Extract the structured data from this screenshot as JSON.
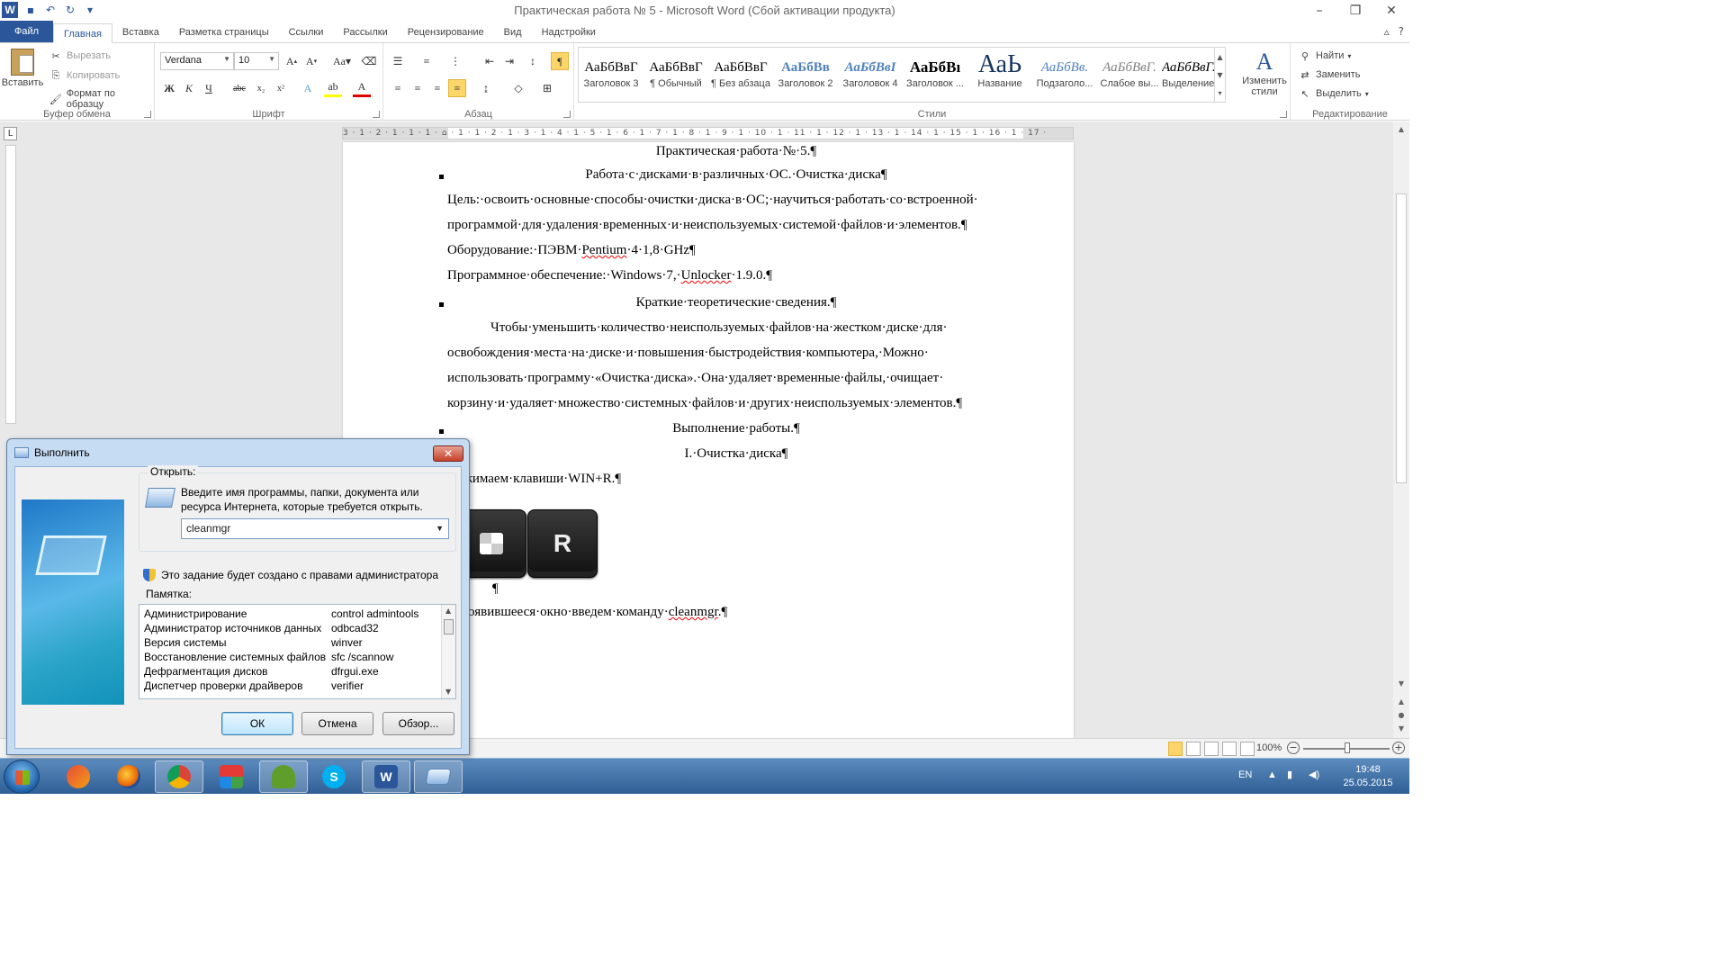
{
  "window": {
    "title": "Практическая работа № 5 - Microsoft Word (Сбой активации продукта)",
    "app_icon": "W"
  },
  "ribbon_tabs": [
    "Файл",
    "Главная",
    "Вставка",
    "Разметка страницы",
    "Ссылки",
    "Рассылки",
    "Рецензирование",
    "Вид",
    "Надстройки"
  ],
  "clipboard": {
    "paste": "Вставить",
    "cut": "Вырезать",
    "copy": "Копировать",
    "format_painter": "Формат по образцу",
    "group": "Буфер обмена"
  },
  "font": {
    "name": "Verdana",
    "size": "10",
    "group": "Шрифт"
  },
  "paragraph": {
    "group": "Абзац"
  },
  "styles": {
    "group": "Стили",
    "items": [
      {
        "sample": "АаБбВвГ",
        "name": "Заголовок 3"
      },
      {
        "sample": "АаБбВвГ",
        "name": "¶ Обычный"
      },
      {
        "sample": "АаБбВвГ",
        "name": "¶ Без абзаца"
      },
      {
        "sample": "АаБбВв",
        "name": "Заголовок 2"
      },
      {
        "sample": "АаБбВвI",
        "name": "Заголовок 4"
      },
      {
        "sample": "АаБбВı",
        "name": "Заголовок ..."
      },
      {
        "sample": "АаЬ",
        "name": "Название"
      },
      {
        "sample": "АаБбВв.",
        "name": "Подзаголо..."
      },
      {
        "sample": "АаБбВвГ.",
        "name": "Слабое вы..."
      },
      {
        "sample": "АаБбВвГ.",
        "name": "Выделение"
      }
    ],
    "change_styles": "Изменить стили"
  },
  "editing": {
    "group": "Редактирование",
    "find": "Найти",
    "replace": "Заменить",
    "select": "Выделить"
  },
  "ruler_text": "3 · 1 · 2 · 1 · 1 · 1 · ⌂ · 1 · 1 · 2 · 1 · 3 · 1 · 4 · 1 · 5 · 1 · 6 · 1 · 7 · 1 · 8 · 1 · 9 · 1 · 10 · 1 · 11 · 1 · 12 · 1 · 13 · 1 · 14 · 1 · 15 · 1 · 16 · 1 · 17 ·",
  "document": {
    "title": "Практическая·работа·№·5.¶",
    "heading1": "Работа·с·дисками·в·различных·ОС.·Очистка·диска¶",
    "goal1": "Цель:·освоить·основные·способы·очистки·диска·в·ОС;·научиться·работать·со·встроенной·",
    "goal2": "программой·для·удаления·временных·и·неиспользуемых·системой·файлов·и·элементов.¶",
    "equip_pre": "Оборудование:·ПЭВМ·",
    "equip_word": "Pentium",
    "equip_post": "·4·1,8·GHz¶",
    "soft_pre": "Программное·обеспечение:·Windows·7,·",
    "soft_word": "Unlocker",
    "soft_post": "·1.9.0.¶",
    "theory": "Краткие·теоретические·сведения.¶",
    "p1": "Чтобы·уменьшить·количество·неиспользуемых·файлов·на·жестком·диске·для·",
    "p2": "освобождения·места·на·диске·и·повышения·быстродействия·компьютера,·Можно·",
    "p3": "использовать·программу·«Очистка·диска».·Она·удаляет·временные·файлы,·очищает·",
    "p4": "корзину·и·удаляет·множество·системных·файлов·и·других·неиспользуемых·элементов.¶",
    "work": "Выполнение·работы.¶",
    "section": "I.·Очистка·диска¶",
    "press": "Нажимаем·клавиши·WIN+R.¶",
    "key_r": "R",
    "empty_para": "¶",
    "cmd_pre": "В·появившееся·окно·введем·команду·",
    "cmd_word": "cleanmgr",
    "cmd_post": ".¶"
  },
  "statusbar": {
    "zoom": "100%"
  },
  "taskbar": {
    "lang": "EN",
    "time": "19:48",
    "date": "25.05.2015"
  },
  "run_dialog": {
    "title": "Выполнить",
    "open_label": "Открыть:",
    "description": "Введите имя программы, папки, документа или ресурса Интернета, которые требуется открыть.",
    "command": "cleanmgr",
    "admin_note": "Это задание будет создано с правами администратора",
    "memo_label": "Памятка:",
    "memo": [
      {
        "name": "Администрирование",
        "cmd": "control admintools"
      },
      {
        "name": "Администратор источников данных",
        "cmd": "odbcad32"
      },
      {
        "name": "Версия системы",
        "cmd": "winver"
      },
      {
        "name": "Восстановление системных файлов",
        "cmd": "sfc /scannow"
      },
      {
        "name": "Дефрагментация дисков",
        "cmd": "dfrgui.exe"
      },
      {
        "name": "Диспетчер проверки драйверов",
        "cmd": "verifier"
      }
    ],
    "ok": "ОК",
    "cancel": "Отмена",
    "browse": "Обзор..."
  },
  "colors": {
    "word_blue": "#2b579a",
    "active_highlight": "#fcd668",
    "taskbar": "#3f6fa6"
  }
}
